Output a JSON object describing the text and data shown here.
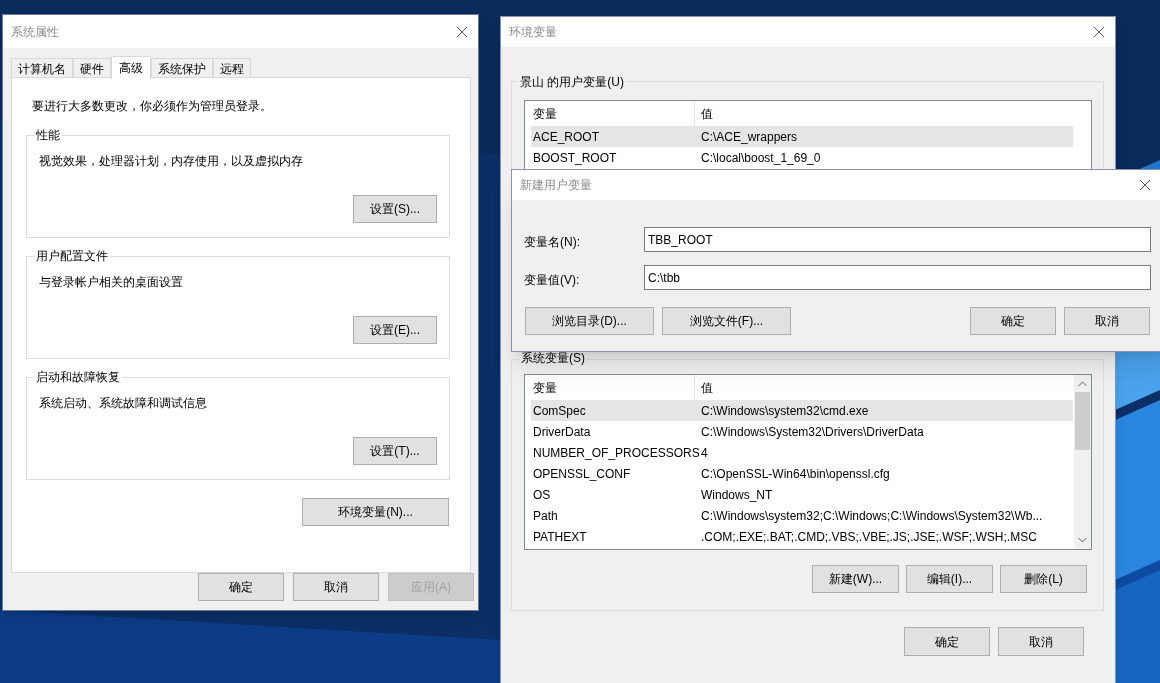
{
  "system_properties": {
    "title": "系统属性",
    "tabs": [
      {
        "label": "计算机名",
        "selected": false
      },
      {
        "label": "硬件",
        "selected": false
      },
      {
        "label": "高级",
        "selected": true
      },
      {
        "label": "系统保护",
        "selected": false
      },
      {
        "label": "远程",
        "selected": false
      }
    ],
    "notice": "要进行大多数更改，你必须作为管理员登录。",
    "groups": [
      {
        "title": "性能",
        "description": "视觉效果，处理器计划，内存使用，以及虚拟内存",
        "button": "设置(S)..."
      },
      {
        "title": "用户配置文件",
        "description": "与登录帐户相关的桌面设置",
        "button": "设置(E)..."
      },
      {
        "title": "启动和故障恢复",
        "description": "系统启动、系统故障和调试信息",
        "button": "设置(T)..."
      }
    ],
    "env_button": "环境变量(N)...",
    "buttons": [
      {
        "label": "确定",
        "disabled": false
      },
      {
        "label": "取消",
        "disabled": false
      },
      {
        "label": "应用(A)",
        "disabled": true
      }
    ]
  },
  "environment_variables": {
    "title": "环境变量",
    "user_group": {
      "title": "景山 的用户变量(U)",
      "columns": [
        "变量",
        "值"
      ],
      "rows": [
        {
          "name": "ACE_ROOT",
          "value": "C:\\ACE_wrappers",
          "selected": true
        },
        {
          "name": "BOOST_ROOT",
          "value": "C:\\local\\boost_1_69_0",
          "selected": false
        }
      ]
    },
    "system_group": {
      "title": "系统变量(S)",
      "columns": [
        "变量",
        "值"
      ],
      "rows": [
        {
          "name": "ComSpec",
          "value": "C:\\Windows\\system32\\cmd.exe",
          "selected": true
        },
        {
          "name": "DriverData",
          "value": "C:\\Windows\\System32\\Drivers\\DriverData",
          "selected": false
        },
        {
          "name": "NUMBER_OF_PROCESSORS",
          "value": "4",
          "selected": false
        },
        {
          "name": "OPENSSL_CONF",
          "value": "C:\\OpenSSL-Win64\\bin\\openssl.cfg",
          "selected": false
        },
        {
          "name": "OS",
          "value": "Windows_NT",
          "selected": false
        },
        {
          "name": "Path",
          "value": "C:\\Windows\\system32;C:\\Windows;C:\\Windows\\System32\\Wb...",
          "selected": false
        },
        {
          "name": "PATHEXT",
          "value": ".COM;.EXE;.BAT;.CMD;.VBS;.VBE;.JS;.JSE;.WSF;.WSH;.MSC",
          "selected": false
        }
      ],
      "buttons": [
        "新建(W)...",
        "编辑(I)...",
        "删除(L)"
      ]
    },
    "buttons": [
      "确定",
      "取消"
    ]
  },
  "new_user_variable": {
    "title": "新建用户变量",
    "fields": [
      {
        "label": "变量名(N):",
        "value": "TBB_ROOT"
      },
      {
        "label": "变量值(V):",
        "value": "C:\\tbb"
      }
    ],
    "browse_buttons": [
      "浏览目录(D)...",
      "浏览文件(F)..."
    ],
    "buttons": [
      "确定",
      "取消"
    ]
  }
}
